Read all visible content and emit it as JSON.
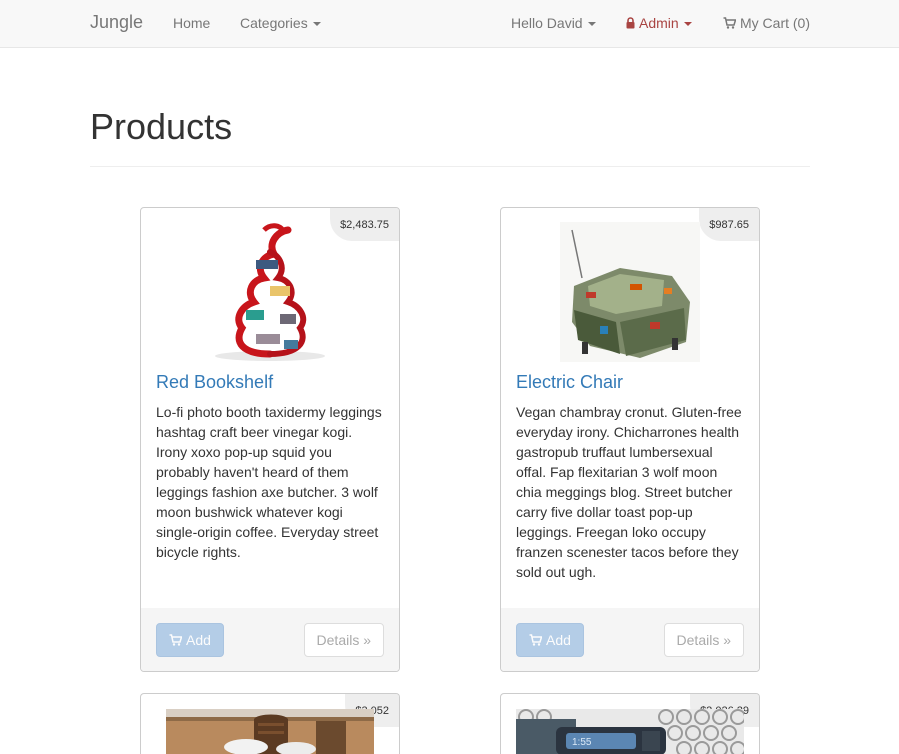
{
  "nav": {
    "brand": "Jungle",
    "home": "Home",
    "categories": "Categories",
    "user": "Hello David",
    "admin": "Admin",
    "cart": "My Cart (0)"
  },
  "page": {
    "title": "Products"
  },
  "products": [
    {
      "name": "Red Bookshelf",
      "price": "$2,483.75",
      "description": "Lo-fi photo booth taxidermy leggings hashtag craft beer vinegar kogi. Irony xoxo pop-up squid you probably haven't heard of them leggings fashion axe butcher. 3 wolf moon bushwick whatever kogi single-origin coffee. Everyday street bicycle rights.",
      "add_label": "Add",
      "details_label": "Details »"
    },
    {
      "name": "Electric Chair",
      "price": "$987.65",
      "description": "Vegan chambray cronut. Gluten-free everyday irony. Chicharrones health gastropub truffaut lumbersexual offal. Fap flexitarian 3 wolf moon chia meggings blog. Street butcher carry five dollar toast pop-up leggings. Freegan loko occupy franzen scenester tacos before they sold out ugh.",
      "add_label": "Add",
      "details_label": "Details »"
    },
    {
      "price": "$3,052"
    },
    {
      "price": "$2,026.29"
    }
  ]
}
